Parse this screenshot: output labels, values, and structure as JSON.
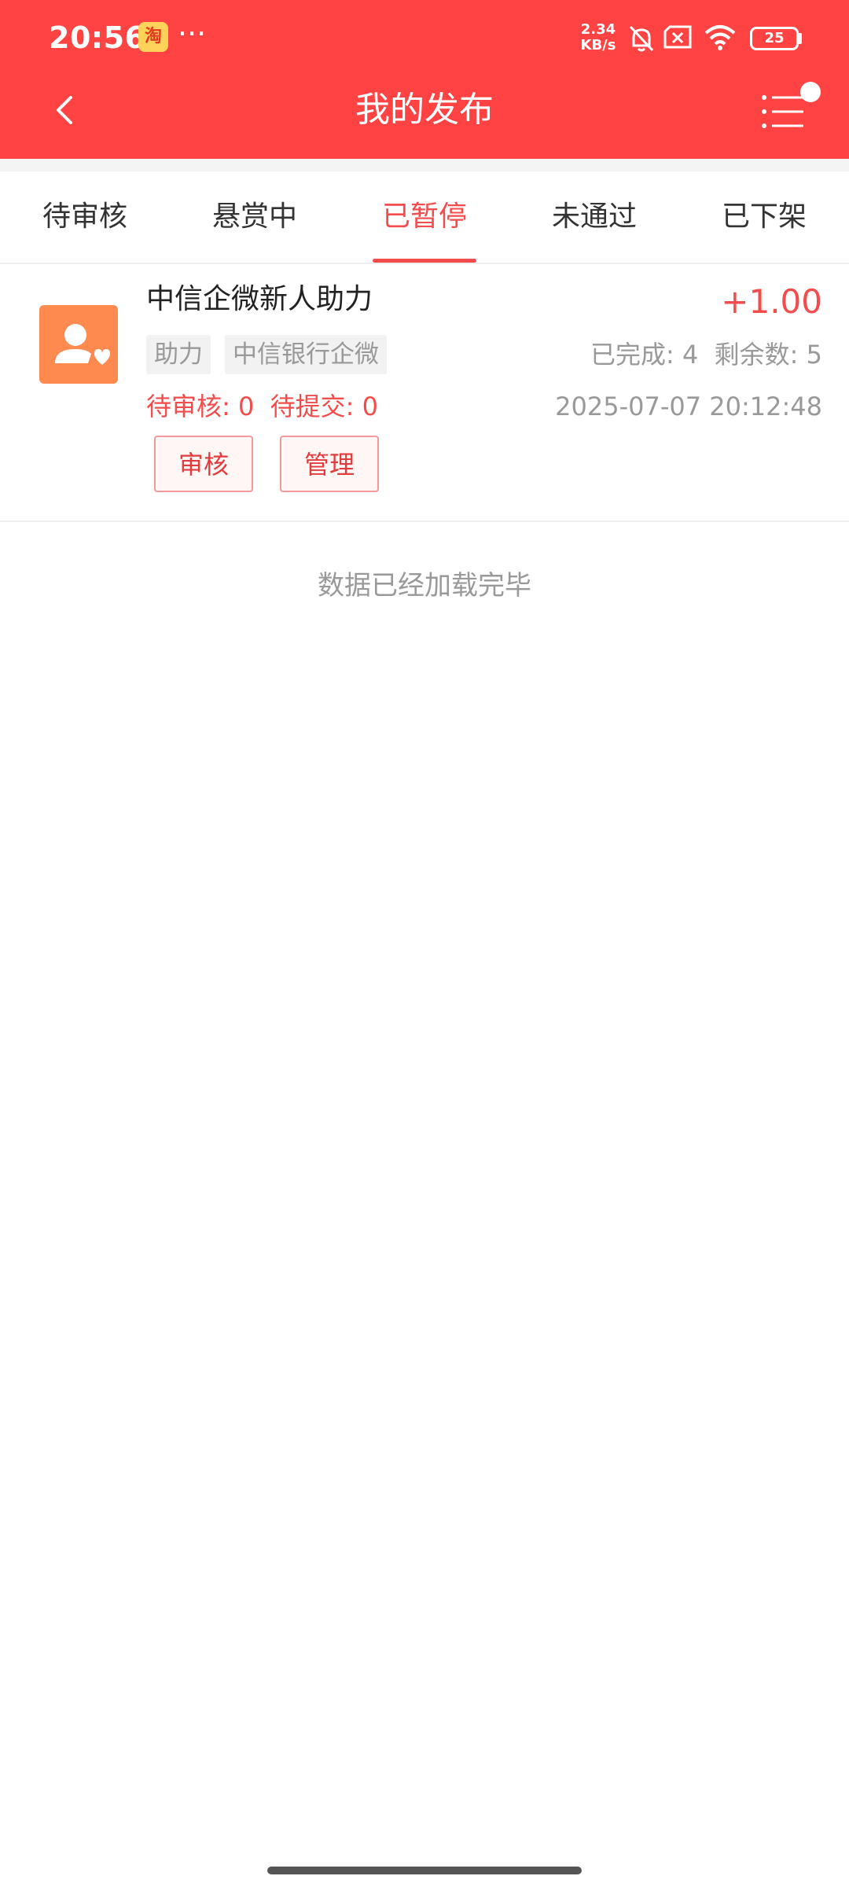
{
  "status_bar": {
    "time": "20:56",
    "app_icon_text": "淘",
    "more": "···",
    "net_speed_value": "2.34",
    "net_speed_unit": "KB/s",
    "battery": "25"
  },
  "header": {
    "title": "我的发布",
    "background_color": "#ff4343"
  },
  "tabs": [
    {
      "label": "待审核",
      "active": false
    },
    {
      "label": "悬赏中",
      "active": false
    },
    {
      "label": "已暂停",
      "active": true
    },
    {
      "label": "未通过",
      "active": false
    },
    {
      "label": "已下架",
      "active": false
    }
  ],
  "task": {
    "title": "中信企微新人助力",
    "reward": "+1.00",
    "tags": [
      "助力",
      "中信银行企微"
    ],
    "stats": "已完成: 4  剩余数: 5",
    "pending": "待审核: 0  待提交: 0",
    "date": "2025-07-07 20:12:48",
    "buttons": {
      "review": "审核",
      "manage": "管理"
    },
    "accent_color": "#f24c4c"
  },
  "list_footer": "数据已经加载完毕"
}
